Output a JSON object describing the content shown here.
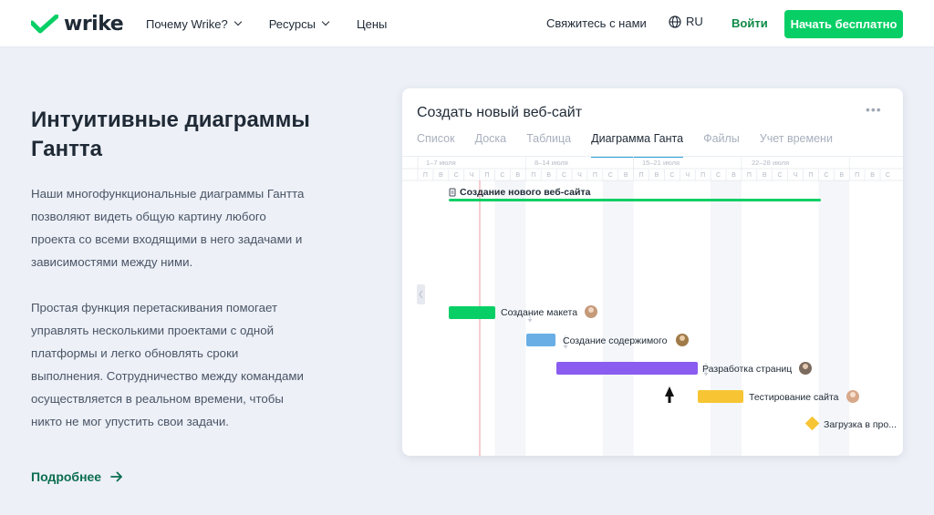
{
  "header": {
    "logo_text": "wrike",
    "nav": [
      {
        "label": "Почему Wrike?",
        "has_dropdown": true
      },
      {
        "label": "Ресурсы",
        "has_dropdown": true
      },
      {
        "label": "Цены",
        "has_dropdown": false
      }
    ],
    "contact_label": "Свяжитесь с нами",
    "lang_label": "RU",
    "login_label": "Войти",
    "cta_label": "Начать бесплатно",
    "brand_color": "#08cf65"
  },
  "hero": {
    "title": "Интуитивные диаграммы Гантта",
    "paragraph1": "Наши многофункциональные диаграммы Гантта позволяют видеть общую картину любого проекта со всеми входящими в него задачами и зависимостями между ними.",
    "paragraph2": "Простая функция перетаскивания помогает управлять несколькими проектами с одной платформы и легко обновлять сроки выполнения. Сотрудничество между командами осуществляется в реальном времени, чтобы никто не мог упустить свои задачи.",
    "more_label": "Подробнее",
    "more_icon": "arrow-right-icon"
  },
  "card": {
    "title": "Создать новый веб-сайт",
    "menu_icon": "more-dots-icon",
    "tabs": [
      {
        "label": "Список",
        "active": false
      },
      {
        "label": "Доска",
        "active": false
      },
      {
        "label": "Таблица",
        "active": false
      },
      {
        "label": "Диаграмма Ганта",
        "active": true
      },
      {
        "label": "Файлы",
        "active": false
      },
      {
        "label": "Учет времени",
        "active": false
      }
    ],
    "weeks": [
      "1–7 июля",
      "8–14 июля",
      "15–21 июля",
      "22–28 июля"
    ],
    "day_letters": [
      "П",
      "В",
      "С",
      "Ч",
      "П",
      "С",
      "В"
    ],
    "project": {
      "label": "Создание нового веб-сайта",
      "icon": "document-icon",
      "color": "#08cf65"
    },
    "tasks": [
      {
        "label": "Создание макета",
        "color": "#08cf65",
        "avatar": "avatar-1"
      },
      {
        "label": "Создание содержимого",
        "color": "#6aaee6",
        "avatar": "avatar-2"
      },
      {
        "label": "Разработка страниц",
        "color": "#8a5cf0",
        "avatar": "avatar-3"
      },
      {
        "label": "Тестирование сайта",
        "color": "#f7c534",
        "avatar": "avatar-4"
      }
    ],
    "milestone": {
      "label": "Загрузка в про...",
      "color": "#f7c534"
    }
  }
}
